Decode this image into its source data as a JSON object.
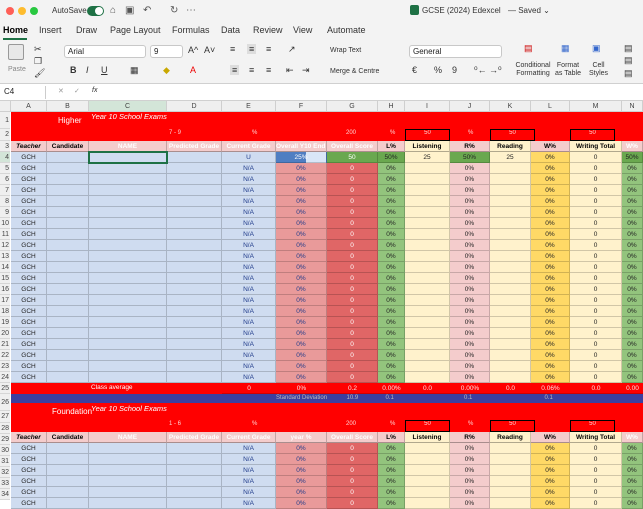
{
  "titlebar": {
    "autosave": "AutoSave",
    "filename": "GCSE (2024) Edexcel",
    "status": "— Saved ⌄"
  },
  "tabs": [
    "Home",
    "Insert",
    "Draw",
    "Page Layout",
    "Formulas",
    "Data",
    "Review",
    "View",
    "Automate"
  ],
  "ribbon": {
    "paste": "Paste",
    "font_name": "Arial",
    "font_size": "9",
    "wrap_text": "Wrap Text",
    "merge_centre": "Merge & Centre",
    "number_format": "General",
    "conditional_formatting": "Conditional Formatting",
    "format_as_table": "Format as Table",
    "cell_styles": "Cell Styles",
    "font_grow": "A^",
    "font_shrink": "A˅",
    "bold": "B",
    "italic": "I",
    "underline": "U",
    "currency": "€",
    "percent": "%",
    "comma": "9"
  },
  "formula_bar": {
    "name_box": "C4",
    "fx": "fx",
    "value": ""
  },
  "columns": [
    "A",
    "B",
    "C",
    "D",
    "E",
    "F",
    "G",
    "H",
    "I",
    "J",
    "K",
    "L",
    "M",
    "N"
  ],
  "higher": {
    "band_label": "Higher",
    "exam_label": "Year 10 School Exams",
    "range_label": "7 - 9",
    "pct_label": "%",
    "total_marks": "200",
    "l_pct_label": "%",
    "listening_max": "50",
    "r_pct_label": "%",
    "reading_max": "50",
    "writing_max": "50",
    "headers": [
      "Teacher",
      "Candidate",
      "NAME",
      "Predicted Grade",
      "Current Grade",
      "Overall Y10 End of year %",
      "Overall Score",
      "L%",
      "Listening",
      "R%",
      "Reading",
      "W%",
      "Writing Total",
      "W%"
    ],
    "first_row": {
      "teacher": "GCH",
      "grade": "U",
      "pct": "25%",
      "score": "50",
      "l": "50%",
      "listening": "25",
      "r": "50%",
      "reading": "25",
      "w": "0%",
      "writing": "0",
      "n": "50%"
    },
    "row_teacher": "GCH",
    "row_grade": "N/A",
    "row_pct": "0%",
    "row_zero": "0",
    "average_label": "Class average",
    "average_values": {
      "e": "0",
      "f": "0%",
      "g": "0.2",
      "h": "0.00%",
      "i": "0.0",
      "j": "0.00%",
      "k": "0.0",
      "l": "0.06%",
      "m": "0.0",
      "n": "0.00"
    },
    "sd_label": "Standard Deviation",
    "sd_values": {
      "g": "10.9",
      "h": "0.1",
      "j": "0.1",
      "l": "0.1"
    }
  },
  "foundation": {
    "band_label": "Foundation",
    "exam_label": "Year 10 School Exams",
    "range_label": "1 - 6",
    "pct_label": "%",
    "total_marks": "200",
    "l_pct_label": "%",
    "listening_max": "50",
    "r_pct_label": "%",
    "reading_max": "50",
    "writing_max": "50",
    "headers": [
      "Teacher",
      "Candidate",
      "NAME",
      "Predicted Grade",
      "Current Grade",
      "year %",
      "Overall Score",
      "L%",
      "Listening",
      "R%",
      "Reading",
      "W%",
      "Writing Total",
      "W%"
    ],
    "row_teacher": "GCH",
    "row_grade": "N/A",
    "row_pct": "0%",
    "row_zero": "0"
  },
  "colors": {
    "red": "#ff0000",
    "pink": "#f4cccc",
    "green": "#6aa84f",
    "yellow": "#fff2cc",
    "blue": "#3c3f9f",
    "lightblue": "#cfdcf0"
  }
}
